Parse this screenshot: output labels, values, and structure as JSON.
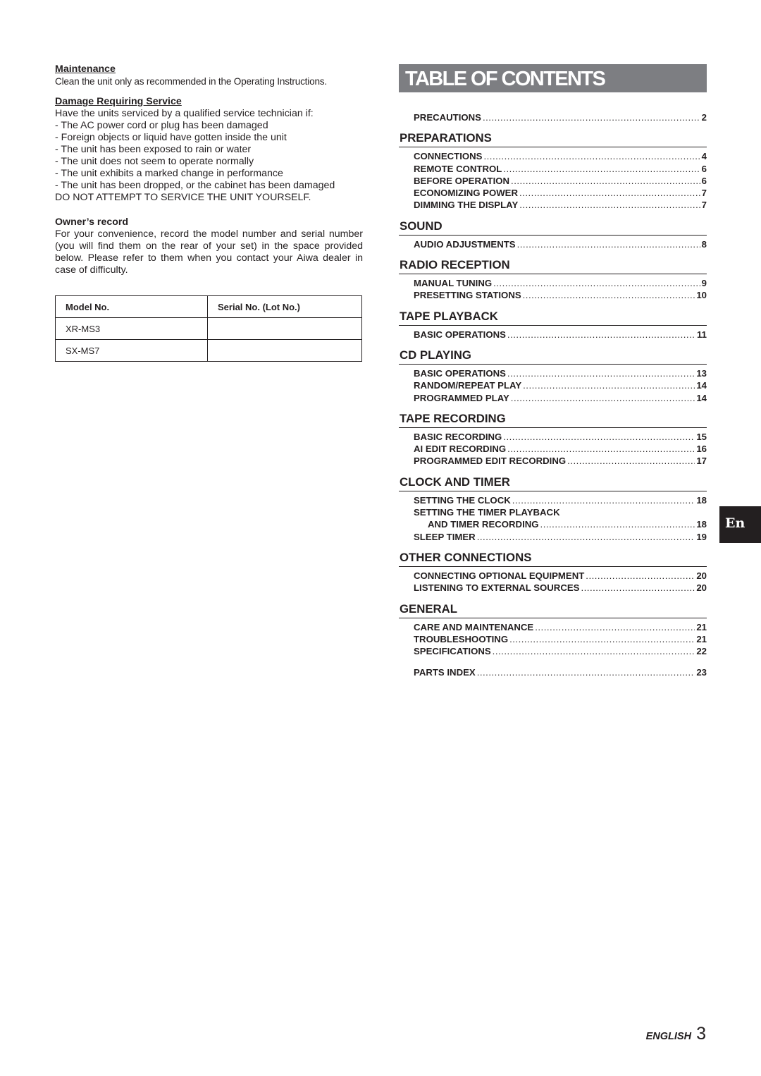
{
  "left": {
    "maintenance": {
      "heading": "Maintenance",
      "text": "Clean the unit only as recommended in the Operating Instructions."
    },
    "damage": {
      "heading": "Damage Requiring Service",
      "intro": "Have the units serviced by a qualified service technician if:",
      "bullets": [
        "- The AC power cord or plug has been damaged",
        "- Foreign objects or liquid have gotten inside the unit",
        "- The unit has been exposed to rain or water",
        "- The unit does not seem to operate normally",
        "- The unit exhibits a marked change in performance",
        "- The unit has been dropped, or the cabinet has been damaged"
      ],
      "warning": "DO NOT ATTEMPT TO SERVICE THE UNIT YOURSELF."
    },
    "owners_record": {
      "heading": "Owner’s record",
      "text": "For your convenience, record the model number and serial number (you will find them on the rear of your set) in the space provided below.  Please refer to them when you contact your Aiwa dealer in case of difficulty."
    },
    "record_table": {
      "headers": [
        "Model No.",
        "Serial No. (Lot No.)"
      ],
      "rows": [
        [
          "XR-MS3",
          ""
        ],
        [
          "SX-MS7",
          ""
        ]
      ]
    }
  },
  "toc": {
    "title": "TABLE OF CONTENTS",
    "precautions": {
      "label": "PRECAUTIONS",
      "page": "2"
    },
    "sections": [
      {
        "title": "PREPARATIONS",
        "entries": [
          {
            "label": "CONNECTIONS",
            "page": "4"
          },
          {
            "label": "REMOTE CONTROL",
            "page": "6"
          },
          {
            "label": "BEFORE OPERATION",
            "page": "6"
          },
          {
            "label": "ECONOMIZING POWER",
            "page": "7"
          },
          {
            "label": "DIMMING THE DISPLAY",
            "page": "7"
          }
        ]
      },
      {
        "title": "SOUND",
        "entries": [
          {
            "label": "AUDIO ADJUSTMENTS",
            "page": "8"
          }
        ]
      },
      {
        "title": "RADIO RECEPTION",
        "entries": [
          {
            "label": "MANUAL TUNING",
            "page": "9"
          },
          {
            "label": "PRESETTING STATIONS",
            "page": "10"
          }
        ]
      },
      {
        "title": "TAPE PLAYBACK",
        "entries": [
          {
            "label": "BASIC OPERATIONS",
            "page": "11"
          }
        ]
      },
      {
        "title": "CD PLAYING",
        "entries": [
          {
            "label": "BASIC OPERATIONS",
            "page": "13"
          },
          {
            "label": "RANDOM/REPEAT PLAY",
            "page": "14"
          },
          {
            "label": "PROGRAMMED PLAY",
            "page": "14"
          }
        ]
      },
      {
        "title": "TAPE RECORDING",
        "entries": [
          {
            "label": "BASIC RECORDING",
            "page": "15"
          },
          {
            "label": "AI EDIT RECORDING",
            "page": "16"
          },
          {
            "label": "PROGRAMMED EDIT RECORDING",
            "page": "17"
          }
        ]
      },
      {
        "title": "CLOCK AND TIMER",
        "entries": [
          {
            "label": "SETTING THE CLOCK",
            "page": "18"
          },
          {
            "label": "SETTING THE TIMER PLAYBACK",
            "page": ""
          },
          {
            "label": "AND TIMER RECORDING",
            "page": "18"
          },
          {
            "label": "SLEEP TIMER",
            "page": "19"
          }
        ]
      },
      {
        "title": "OTHER CONNECTIONS",
        "entries": [
          {
            "label": "CONNECTING OPTIONAL EQUIPMENT",
            "page": "20"
          },
          {
            "label": "LISTENING TO EXTERNAL SOURCES",
            "page": "20"
          }
        ]
      },
      {
        "title": "GENERAL",
        "entries": [
          {
            "label": "CARE AND MAINTENANCE",
            "page": "21"
          },
          {
            "label": "TROUBLESHOOTING",
            "page": "21"
          },
          {
            "label": "SPECIFICATIONS",
            "page": "22"
          }
        ]
      }
    ],
    "parts_index": {
      "label": "PARTS INDEX",
      "page": "23"
    }
  },
  "side_tab": "En",
  "footer": {
    "language": "ENGLISH",
    "page_number": "3"
  },
  "colors": {
    "banner": "#7d7e82",
    "text": "#231f20",
    "tab": "#231f20"
  }
}
